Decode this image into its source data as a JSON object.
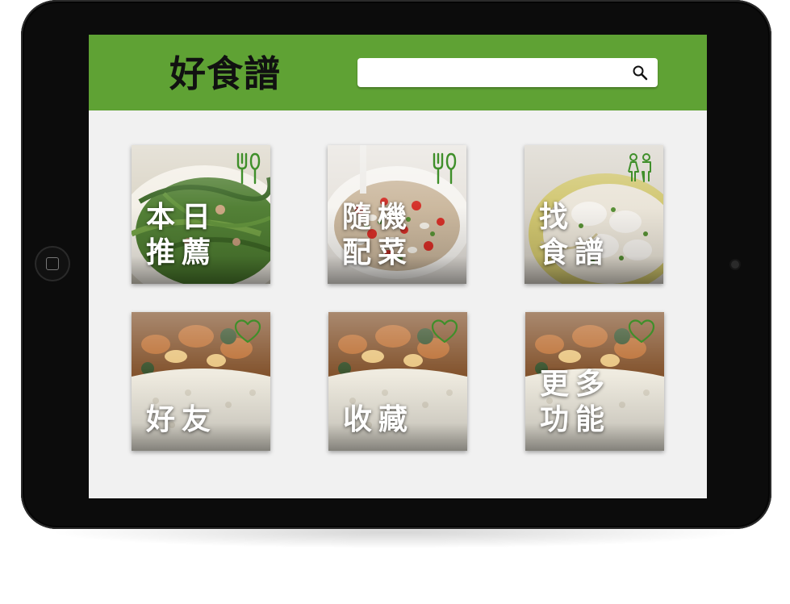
{
  "app": {
    "logo_text": "好食譜"
  },
  "header": {
    "background_color": "#5fa234",
    "search": {
      "value": "",
      "placeholder": "",
      "icon": "search-icon"
    }
  },
  "tiles": [
    {
      "label": "本日\n推薦",
      "icon": "utensils-icon"
    },
    {
      "label": "隨機\n配菜",
      "icon": "utensils-icon"
    },
    {
      "label": "找\n食譜",
      "icon": "people-icon"
    },
    {
      "label": "好友",
      "icon": "heart-icon"
    },
    {
      "label": "收藏",
      "icon": "heart-icon"
    },
    {
      "label": "更多\n功能",
      "icon": "heart-icon"
    }
  ],
  "colors": {
    "accent": "#5fa234",
    "icon_outline": "#3f8f2a",
    "screen_bg": "#f1f1f1"
  }
}
